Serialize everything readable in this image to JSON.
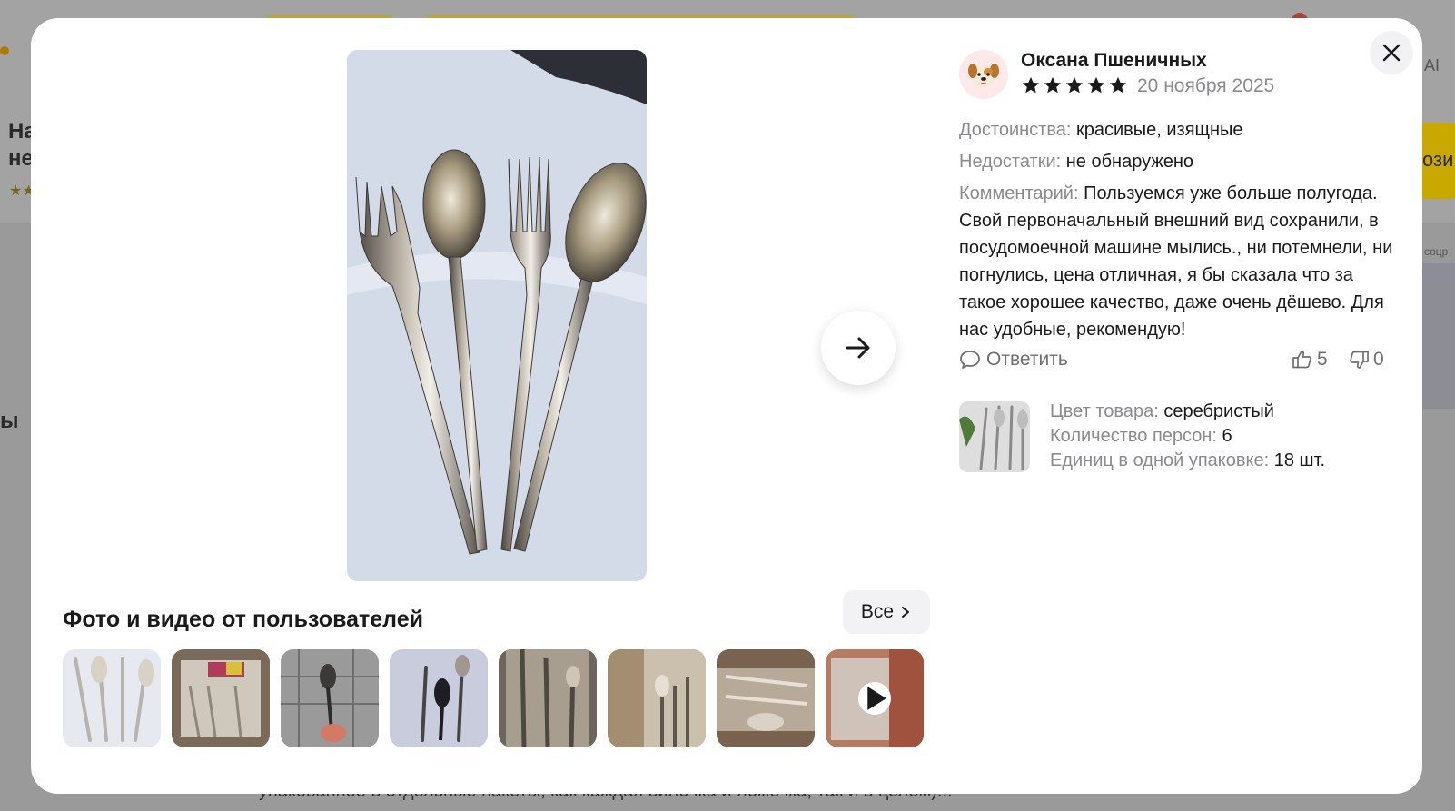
{
  "background": {
    "title_fragment_1": "На",
    "title_fragment_2": "не",
    "side_fragment": "ы",
    "cta_fragment": "ози",
    "ai_fragment": "AI",
    "side_label_fragment": "соцр",
    "bottom_text": "упакованное в отдельные пакеты, как каждая вилочка и ложечка, так и в целом)..."
  },
  "gallery": {
    "title": "Фото и видео от пользователей",
    "all_button_label": "Все",
    "thumbnails": [
      {
        "kind": "photo"
      },
      {
        "kind": "photo"
      },
      {
        "kind": "photo"
      },
      {
        "kind": "photo"
      },
      {
        "kind": "photo"
      },
      {
        "kind": "photo"
      },
      {
        "kind": "photo"
      },
      {
        "kind": "video",
        "icon": "play-icon"
      }
    ]
  },
  "review": {
    "author": "Оксана Пшеничных",
    "rating": 5,
    "rating_max": 5,
    "date": "20 ноября 2025",
    "pros_label": "Достоинства:",
    "pros": "красивые, изящные",
    "cons_label": "Недостатки:",
    "cons": "не обнаружено",
    "comment_label": "Комментарий:",
    "comment": "Пользуемся уже больше полугода. Свой первоначальный внешний вид сохранили, в посудомоечной машине мылись., ни потемнели, ни погнулись, цена отличная, я бы сказала что за такое хорошее качество, даже очень дёшево. Для нас удобные, рекомендую!",
    "reply_label": "Ответить",
    "likes": "5",
    "dislikes": "0"
  },
  "product": {
    "props": [
      {
        "label": "Цвет товара:",
        "value": "серебристый"
      },
      {
        "label": "Количество персон:",
        "value": "6"
      },
      {
        "label": "Единиц в одной упаковке:",
        "value": "18 шт."
      }
    ]
  },
  "icons": {
    "close": "close-icon",
    "next": "arrow-right-icon",
    "chevron": "chevron-right-icon",
    "reply": "comment-icon",
    "like": "thumbs-up-icon",
    "dislike": "thumbs-down-icon",
    "star": "star-icon",
    "avatar": "dog-avatar-icon"
  },
  "colors": {
    "muted_text": "#8a8a8f",
    "star": "#1a1a1a",
    "button_bg": "#f2f2f4"
  }
}
